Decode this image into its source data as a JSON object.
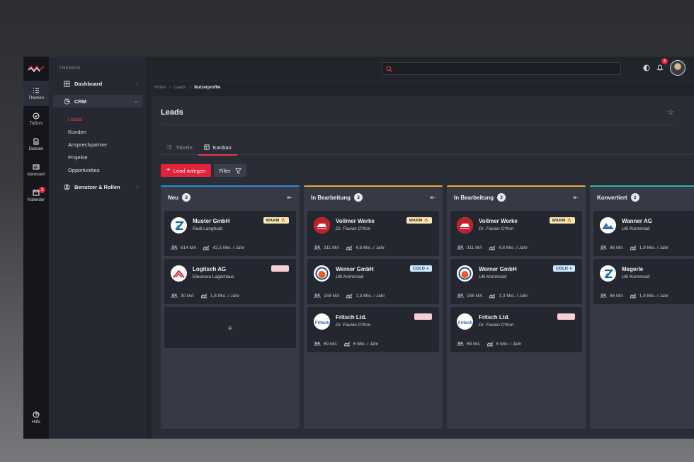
{
  "rail": {
    "items": [
      {
        "label": "Themen"
      },
      {
        "label": "ToDo's"
      },
      {
        "label": "Dateien"
      },
      {
        "label": "Adressen"
      },
      {
        "label": "Kalender",
        "badge": "3"
      }
    ],
    "help": "Hilfe"
  },
  "sidebar": {
    "heading": "THEMEN",
    "dashboard": "Dashboard",
    "crm": "CRM",
    "subitems": [
      "Leads",
      "Kunden",
      "Ansprechpartner",
      "Projekte",
      "Opportunities"
    ],
    "users": "Benutzer & Rollen"
  },
  "topbar": {
    "search_placeholder": "",
    "notif_count": "3"
  },
  "breadcrumb": [
    "Home",
    "Leads",
    "Nutzerprofile"
  ],
  "page": {
    "title": "Leads",
    "tabs": [
      "Tabelle",
      "Kanban"
    ],
    "add_button": "Lead anlegen",
    "filter_button": "Filter"
  },
  "colors": {
    "accent": "#e0233a",
    "col_blue": "#2d8bd6",
    "col_yellow": "#e3a92b",
    "col_teal": "#2bb5a9"
  },
  "columns": [
    {
      "title": "Neu",
      "count": "2",
      "cards": [
        {
          "name": "Muster GmbH",
          "person": "Rudi Langhold",
          "tag": "WARM",
          "employees": "614 MA",
          "revenue": "42,5 Mio. / Jahr",
          "logo": "z-logo"
        },
        {
          "name": "Logitsch AG",
          "person": "Eleonora Lagerhaus",
          "tag": "",
          "employees": "30 MA",
          "revenue": "1,8 Mio. / Jahr",
          "logo": "mountain-logo"
        }
      ]
    },
    {
      "title": "In Bearbeitung",
      "count": "3",
      "cards": [
        {
          "name": "Vollmer Werke",
          "person": "Dr. Favion O'Kon",
          "tag": "WARM",
          "employees": "311 MA",
          "revenue": "4,8 Mio. / Jahr",
          "logo": "train-logo"
        },
        {
          "name": "Werner GmbH",
          "person": "Ulli Kommrad",
          "tag": "COLD",
          "employees": "158 MA",
          "revenue": "1,3 Mio. / Jahr",
          "logo": "circle-logo"
        },
        {
          "name": "Fritsch Ltd.",
          "person": "Dr. Favion O'Kon",
          "tag": "",
          "employees": "69 MA",
          "revenue": "6 Mio. / Jahr",
          "logo": "fritsch-logo"
        }
      ]
    },
    {
      "title": "In Bearbeitung",
      "count": "3",
      "cards": [
        {
          "name": "Vollmer Werke",
          "person": "Dr. Favion O'Kon",
          "tag": "WARM",
          "employees": "311 MA",
          "revenue": "4,8 Mio. / Jahr",
          "logo": "train-logo"
        },
        {
          "name": "Werner GmbH",
          "person": "Ulli Kommrad",
          "tag": "COLD",
          "employees": "158 MA",
          "revenue": "1,3 Mio. / Jahr",
          "logo": "circle-logo"
        },
        {
          "name": "Fritsch Ltd.",
          "person": "Dr. Favion O'Kon",
          "tag": "",
          "employees": "69 MA",
          "revenue": "6 Mio. / Jahr",
          "logo": "fritsch-logo"
        }
      ]
    },
    {
      "title": "Konvertiert",
      "count": "2",
      "cards": [
        {
          "name": "Wanner AG",
          "person": "Ulli Kommrad",
          "tag": "",
          "employees": "86 MA",
          "revenue": "1,8 Mio. / Jahr",
          "logo": "wanner-logo"
        },
        {
          "name": "Megerle",
          "person": "Ulli Kommrad",
          "tag": "",
          "employees": "86 MA",
          "revenue": "1,8 Mio. / Jahr",
          "logo": "z-logo"
        }
      ]
    }
  ],
  "fritsch_logo_text": "Fritsch."
}
